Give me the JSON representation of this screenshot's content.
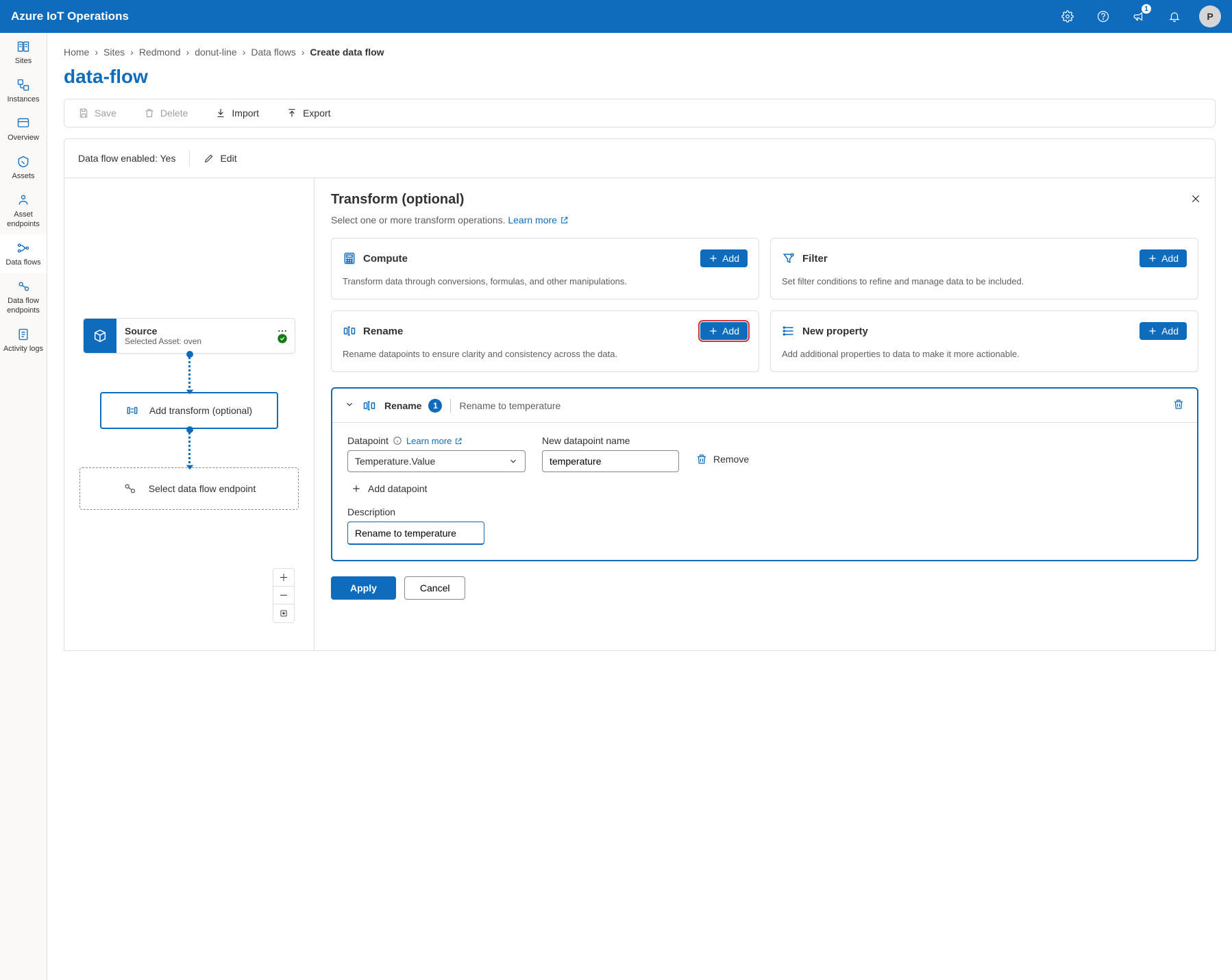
{
  "app_title": "Azure IoT Operations",
  "notification_count": "1",
  "avatar_initial": "P",
  "side_nav": [
    {
      "label": "Sites"
    },
    {
      "label": "Instances"
    },
    {
      "label": "Overview"
    },
    {
      "label": "Assets"
    },
    {
      "label": "Asset endpoints"
    },
    {
      "label": "Data flows"
    },
    {
      "label": "Data flow endpoints"
    },
    {
      "label": "Activity logs"
    }
  ],
  "breadcrumbs": [
    "Home",
    "Sites",
    "Redmond",
    "donut-line",
    "Data flows",
    "Create data flow"
  ],
  "page_title": "data-flow",
  "toolbar": {
    "save": "Save",
    "delete": "Delete",
    "import": "Import",
    "export": "Export"
  },
  "status": {
    "enabled_text": "Data flow enabled: Yes",
    "edit": "Edit"
  },
  "flow": {
    "source_title": "Source",
    "source_sub": "Selected Asset: oven",
    "transform_title": "Add transform (optional)",
    "endpoint_title": "Select data flow endpoint"
  },
  "panel": {
    "title": "Transform (optional)",
    "subtitle": "Select one or more transform operations.",
    "learn_more": "Learn more",
    "cards": {
      "compute": {
        "title": "Compute",
        "desc": "Transform data through conversions, formulas, and other manipulations.",
        "add": "Add"
      },
      "filter": {
        "title": "Filter",
        "desc": "Set filter conditions to refine and manage data to be included.",
        "add": "Add"
      },
      "rename": {
        "title": "Rename",
        "desc": "Rename datapoints to ensure clarity and consistency across the data.",
        "add": "Add"
      },
      "newprop": {
        "title": "New property",
        "desc": "Add additional properties to data to make it more actionable.",
        "add": "Add"
      }
    },
    "rename_block": {
      "label": "Rename",
      "count": "1",
      "summary": "Rename to temperature",
      "datapoint_label": "Datapoint",
      "learn_more": "Learn more",
      "datapoint_value": "Temperature.Value",
      "new_name_label": "New datapoint name",
      "new_name_value": "temperature",
      "remove": "Remove",
      "add_dp": "Add datapoint",
      "desc_label": "Description",
      "desc_value": "Rename to temperature"
    },
    "apply": "Apply",
    "cancel": "Cancel"
  }
}
